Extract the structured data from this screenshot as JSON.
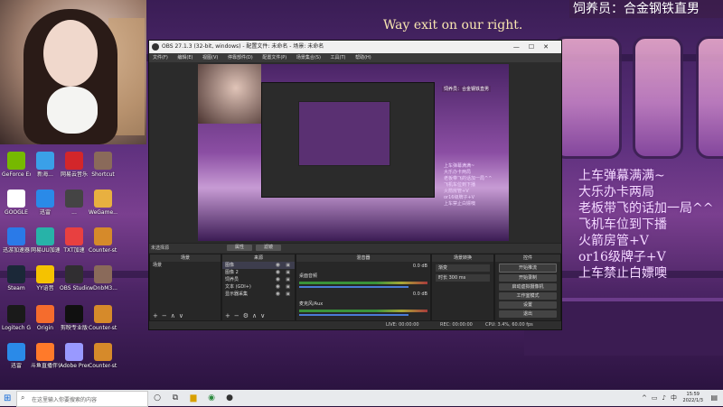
{
  "stream_overlay": {
    "banner": "Way exit on our right.",
    "title_badge": "饲养员：合金钢铁直男",
    "rules_lines": [
      "上车弹幕满满~",
      "大乐办卡两局",
      "老板带飞的话加一局^^",
      "飞机车位到下播",
      "火箭房管+V",
      "or16级牌子+V",
      "上车禁止白嫖噢"
    ]
  },
  "desktop_icons": [
    {
      "label": "GeForce Experience",
      "color": "#76b900"
    },
    {
      "label": "新海...",
      "color": "#3aa0e8"
    },
    {
      "label": "网易云音乐",
      "color": "#d3262a"
    },
    {
      "label": "Shortcut",
      "color": "#8a6a5a"
    },
    {
      "label": "GOOGLE",
      "color": "#ffffff"
    },
    {
      "label": "迅雷",
      "color": "#2a8ae8"
    },
    {
      "label": "...",
      "color": "#444444"
    },
    {
      "label": "WeGame...",
      "color": "#e8b040"
    },
    {
      "label": "迅游加速器",
      "color": "#2a7ae8"
    },
    {
      "label": "网易UU加速",
      "color": "#27b3a8"
    },
    {
      "label": "TXT加速",
      "color": "#e84040"
    },
    {
      "label": "Counter-st... Global Of...",
      "color": "#d68a2a"
    },
    {
      "label": "Steam",
      "color": "#1b2838"
    },
    {
      "label": "YY语音",
      "color": "#f5c200"
    },
    {
      "label": "OBS Studio",
      "color": "#302e31"
    },
    {
      "label": "wDnbM3...",
      "color": "#8a6a5a"
    },
    {
      "label": "Logitech G HUB",
      "color": "#1a1a1a"
    },
    {
      "label": "Origin",
      "color": "#f56c2d"
    },
    {
      "label": "剪映专业版",
      "color": "#101010"
    },
    {
      "label": "Counter-st... Global Of...",
      "color": "#d68a2a"
    },
    {
      "label": "迅雷",
      "color": "#2a8ae8"
    },
    {
      "label": "斗鱼直播伴侣",
      "color": "#ff7a2a"
    },
    {
      "label": "Adobe Premie...",
      "color": "#9999ff"
    },
    {
      "label": "Counter-st... Global Of...",
      "color": "#d68a2a"
    }
  ],
  "obs": {
    "title": "OBS 27.1.3 (32-bit, windows) - 配置文件: 未命名 - 场景: 未命名",
    "menu": [
      "文件(F)",
      "编辑(E)",
      "视图(V)",
      "停靠部件(D)",
      "配置文件(P)",
      "场景集合(S)",
      "工具(T)",
      "帮助(H)"
    ],
    "preview_overlay": "饲养员：合金钢铁直男",
    "preview_lines": [
      "上车弹幕满满~",
      "大乐办卡两局",
      "老板带飞的话加一局^^",
      "飞机车位到下播",
      "火箭房管+V",
      "or16级牌子+V",
      "上车禁止白嫖噢"
    ],
    "scene_bar": {
      "label": "未选择源",
      "props": "属性",
      "filters": "滤镜"
    },
    "docks": {
      "scenes": {
        "header": "场景",
        "items": [
          "场景"
        ]
      },
      "sources": {
        "header": "来源",
        "items": [
          {
            "label": "图像",
            "selected": true
          },
          {
            "label": "图像 2",
            "selected": false
          },
          {
            "label": "饲养员",
            "selected": false
          },
          {
            "label": "文本 (GDI+)",
            "selected": false
          },
          {
            "label": "显示器采集",
            "selected": false
          }
        ]
      },
      "mixer": {
        "header": "混音器",
        "channels": [
          {
            "name": "桌面音频",
            "db": "0.0 dB",
            "level": 0.85
          },
          {
            "name": "麦克风/Aux",
            "db": "0.0 dB",
            "level": 0.85
          }
        ]
      },
      "transitions": {
        "header": "场景转换",
        "type": "渐变",
        "duration_label": "时长",
        "duration": "300 ms"
      },
      "controls": {
        "header": "控件",
        "buttons": [
          "开始推流",
          "开始录制",
          "启动虚拟摄像机",
          "工作室模式",
          "设置",
          "退出"
        ]
      }
    },
    "status": {
      "live": "LIVE: 00:00:00",
      "rec": "REC: 00:00:00",
      "cpu": "CPU: 3.4%, 60.00 fps"
    }
  },
  "taskbar": {
    "search_placeholder": "在这里输入你要搜索的内容",
    "time": "15:59",
    "date": "2022/1/3"
  }
}
